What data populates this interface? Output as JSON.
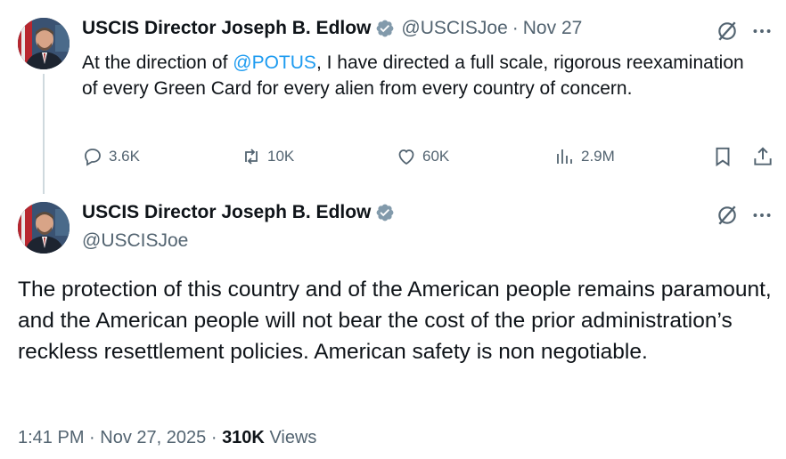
{
  "tweet1": {
    "author_name": "USCIS Director Joseph B. Edlow",
    "handle": "@USCISJoe",
    "separator": "·",
    "date": "Nov 27",
    "text_before": "At the direction of ",
    "mention": "@POTUS",
    "text_after": ", I have directed a full scale, rigorous reexamination of every Green Card for every alien from every country of concern.",
    "actions": {
      "replies": "3.6K",
      "reposts": "10K",
      "likes": "60K",
      "views": "2.9M"
    }
  },
  "tweet2": {
    "author_name": "USCIS Director Joseph B. Edlow",
    "handle": "@USCISJoe",
    "text": "The protection of this country and of the American people remains paramount, and the American people will not bear the cost of the prior administration’s reckless resettlement policies. American safety is non negotiable.",
    "time": "1:41 PM",
    "separator": "·",
    "date": "Nov 27, 2025",
    "views_count": "310K",
    "views_label": "Views"
  },
  "icons": {
    "verified": "verified-badge-icon",
    "grok": "grok-icon",
    "more": "more-icon",
    "reply": "reply-icon",
    "repost": "repost-icon",
    "like": "like-icon",
    "views": "views-icon",
    "bookmark": "bookmark-icon",
    "share": "share-icon"
  },
  "colors": {
    "accent": "#1d9bf0",
    "text": "#0f1419",
    "secondary": "#536471",
    "badge": "#829aab"
  }
}
